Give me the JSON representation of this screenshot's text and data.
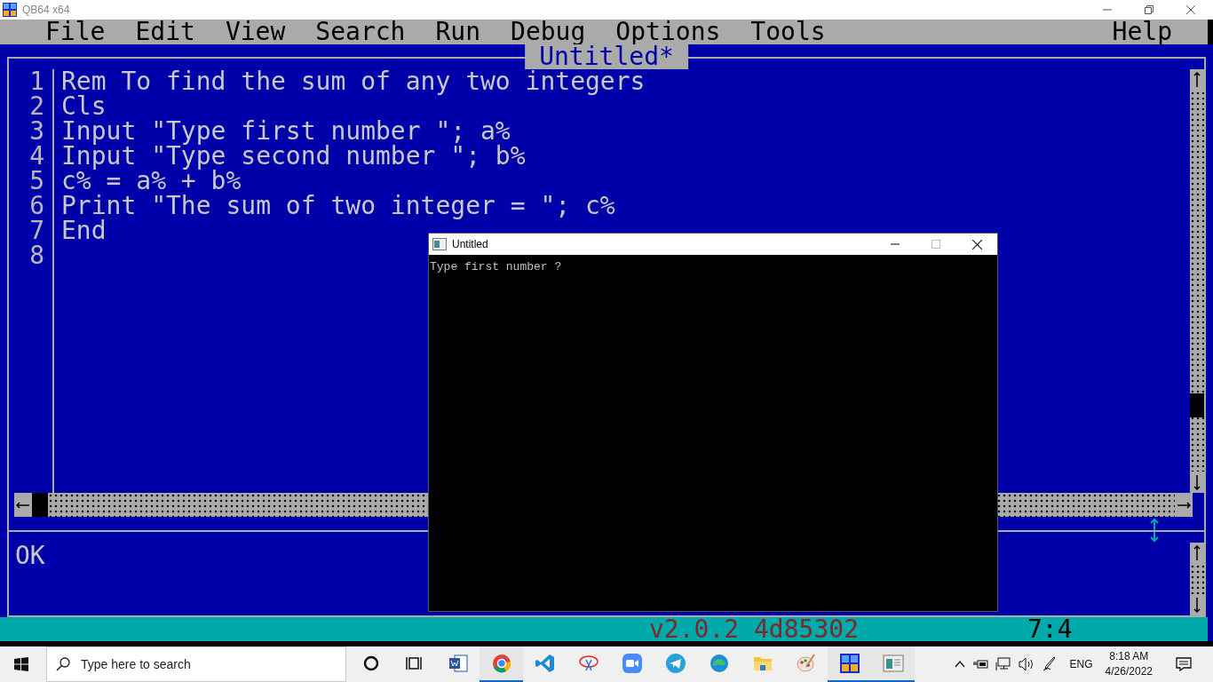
{
  "window": {
    "title": "QB64 x64"
  },
  "menu": [
    {
      "label": "File"
    },
    {
      "label": "Edit"
    },
    {
      "label": "View"
    },
    {
      "label": "Search"
    },
    {
      "label": "Run"
    },
    {
      "label": "Debug"
    },
    {
      "label": "Options"
    },
    {
      "label": "Tools"
    },
    {
      "label": "Help"
    }
  ],
  "editor": {
    "title": "Untitled*",
    "lines": [
      {
        "number": "1",
        "code": "Rem To find the sum of any two integers"
      },
      {
        "number": "2",
        "code": "Cls"
      },
      {
        "number": "3",
        "code": "Input \"Type first number \"; a%"
      },
      {
        "number": "4",
        "code": "Input \"Type second number \"; b%"
      },
      {
        "number": "5",
        "code": "c% = a% + b%"
      },
      {
        "number": "6",
        "code": "Print \"The sum of two integer = \"; c%"
      },
      {
        "number": "7",
        "code": "End"
      },
      {
        "number": "8"
      }
    ]
  },
  "immediate": {
    "text": "OK"
  },
  "status_bar": {
    "version": "v2.0.2 4d85302",
    "position": "7:4"
  },
  "console": {
    "title": "Untitled",
    "output": "Type first number ?"
  },
  "taskbar": {
    "search": {
      "placeholder": "Type here to search"
    },
    "apps": [
      {
        "kind": "cortana",
        "running": false
      },
      {
        "kind": "taskview",
        "running": false
      },
      {
        "kind": "word",
        "running": false
      },
      {
        "kind": "chrome",
        "running": true
      },
      {
        "kind": "vscode",
        "running": false
      },
      {
        "kind": "snip",
        "running": false
      },
      {
        "kind": "zoom",
        "running": false
      },
      {
        "kind": "telegram",
        "running": false
      },
      {
        "kind": "edge",
        "running": false
      },
      {
        "kind": "folder",
        "running": false
      },
      {
        "kind": "paint",
        "running": false
      },
      {
        "kind": "qb",
        "running": true
      },
      {
        "kind": "console",
        "running": true
      }
    ],
    "tray": {
      "language": "ENG",
      "time": "8:18 AM",
      "date": "4/26/2022"
    }
  }
}
